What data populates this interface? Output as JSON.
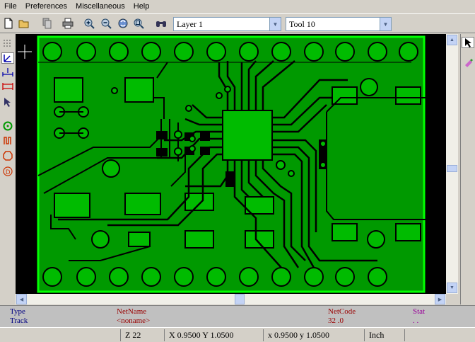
{
  "menu": {
    "file": "File",
    "preferences": "Preferences",
    "misc": "Miscellaneous",
    "help": "Help"
  },
  "layer_select": {
    "value": "Layer 1"
  },
  "tool_select": {
    "value": "Tool 10"
  },
  "info_panel": {
    "headers": {
      "type": "Type",
      "netname": "NetName",
      "netcode": "NetCode",
      "stat": "Stat"
    },
    "values": {
      "type": "Track",
      "netname": "<noname>",
      "netcode": "32 .0",
      "stat": ". ."
    }
  },
  "status": {
    "zoom": "Z 22",
    "abs_coords": "X 0.9500  Y 1.0500",
    "rel_coords": "x 0.9500  y 1.0500",
    "units": "Inch"
  },
  "colors": {
    "board": "#009900",
    "copper_bright": "#00cc00",
    "outline": "#00ff00",
    "background": "#000000",
    "netname": "#990000",
    "stat": "#990099"
  },
  "icons": {
    "toolbar": [
      "new-file-icon",
      "open-folder-icon",
      "copy-icon",
      "print-icon",
      "zoom-in-icon",
      "zoom-out-icon",
      "redraw-icon",
      "zoom-fit-icon",
      "find-icon"
    ],
    "left": [
      "grid-icon",
      "polar-coords-icon",
      "units-inch-icon",
      "units-mm-icon",
      "cursor-shape-icon",
      "show-pads-icon",
      "show-tracks-icon",
      "show-polygons-icon",
      "show-dcodes-icon"
    ],
    "right": [
      "select-arrow-icon",
      "delete-item-icon"
    ]
  }
}
